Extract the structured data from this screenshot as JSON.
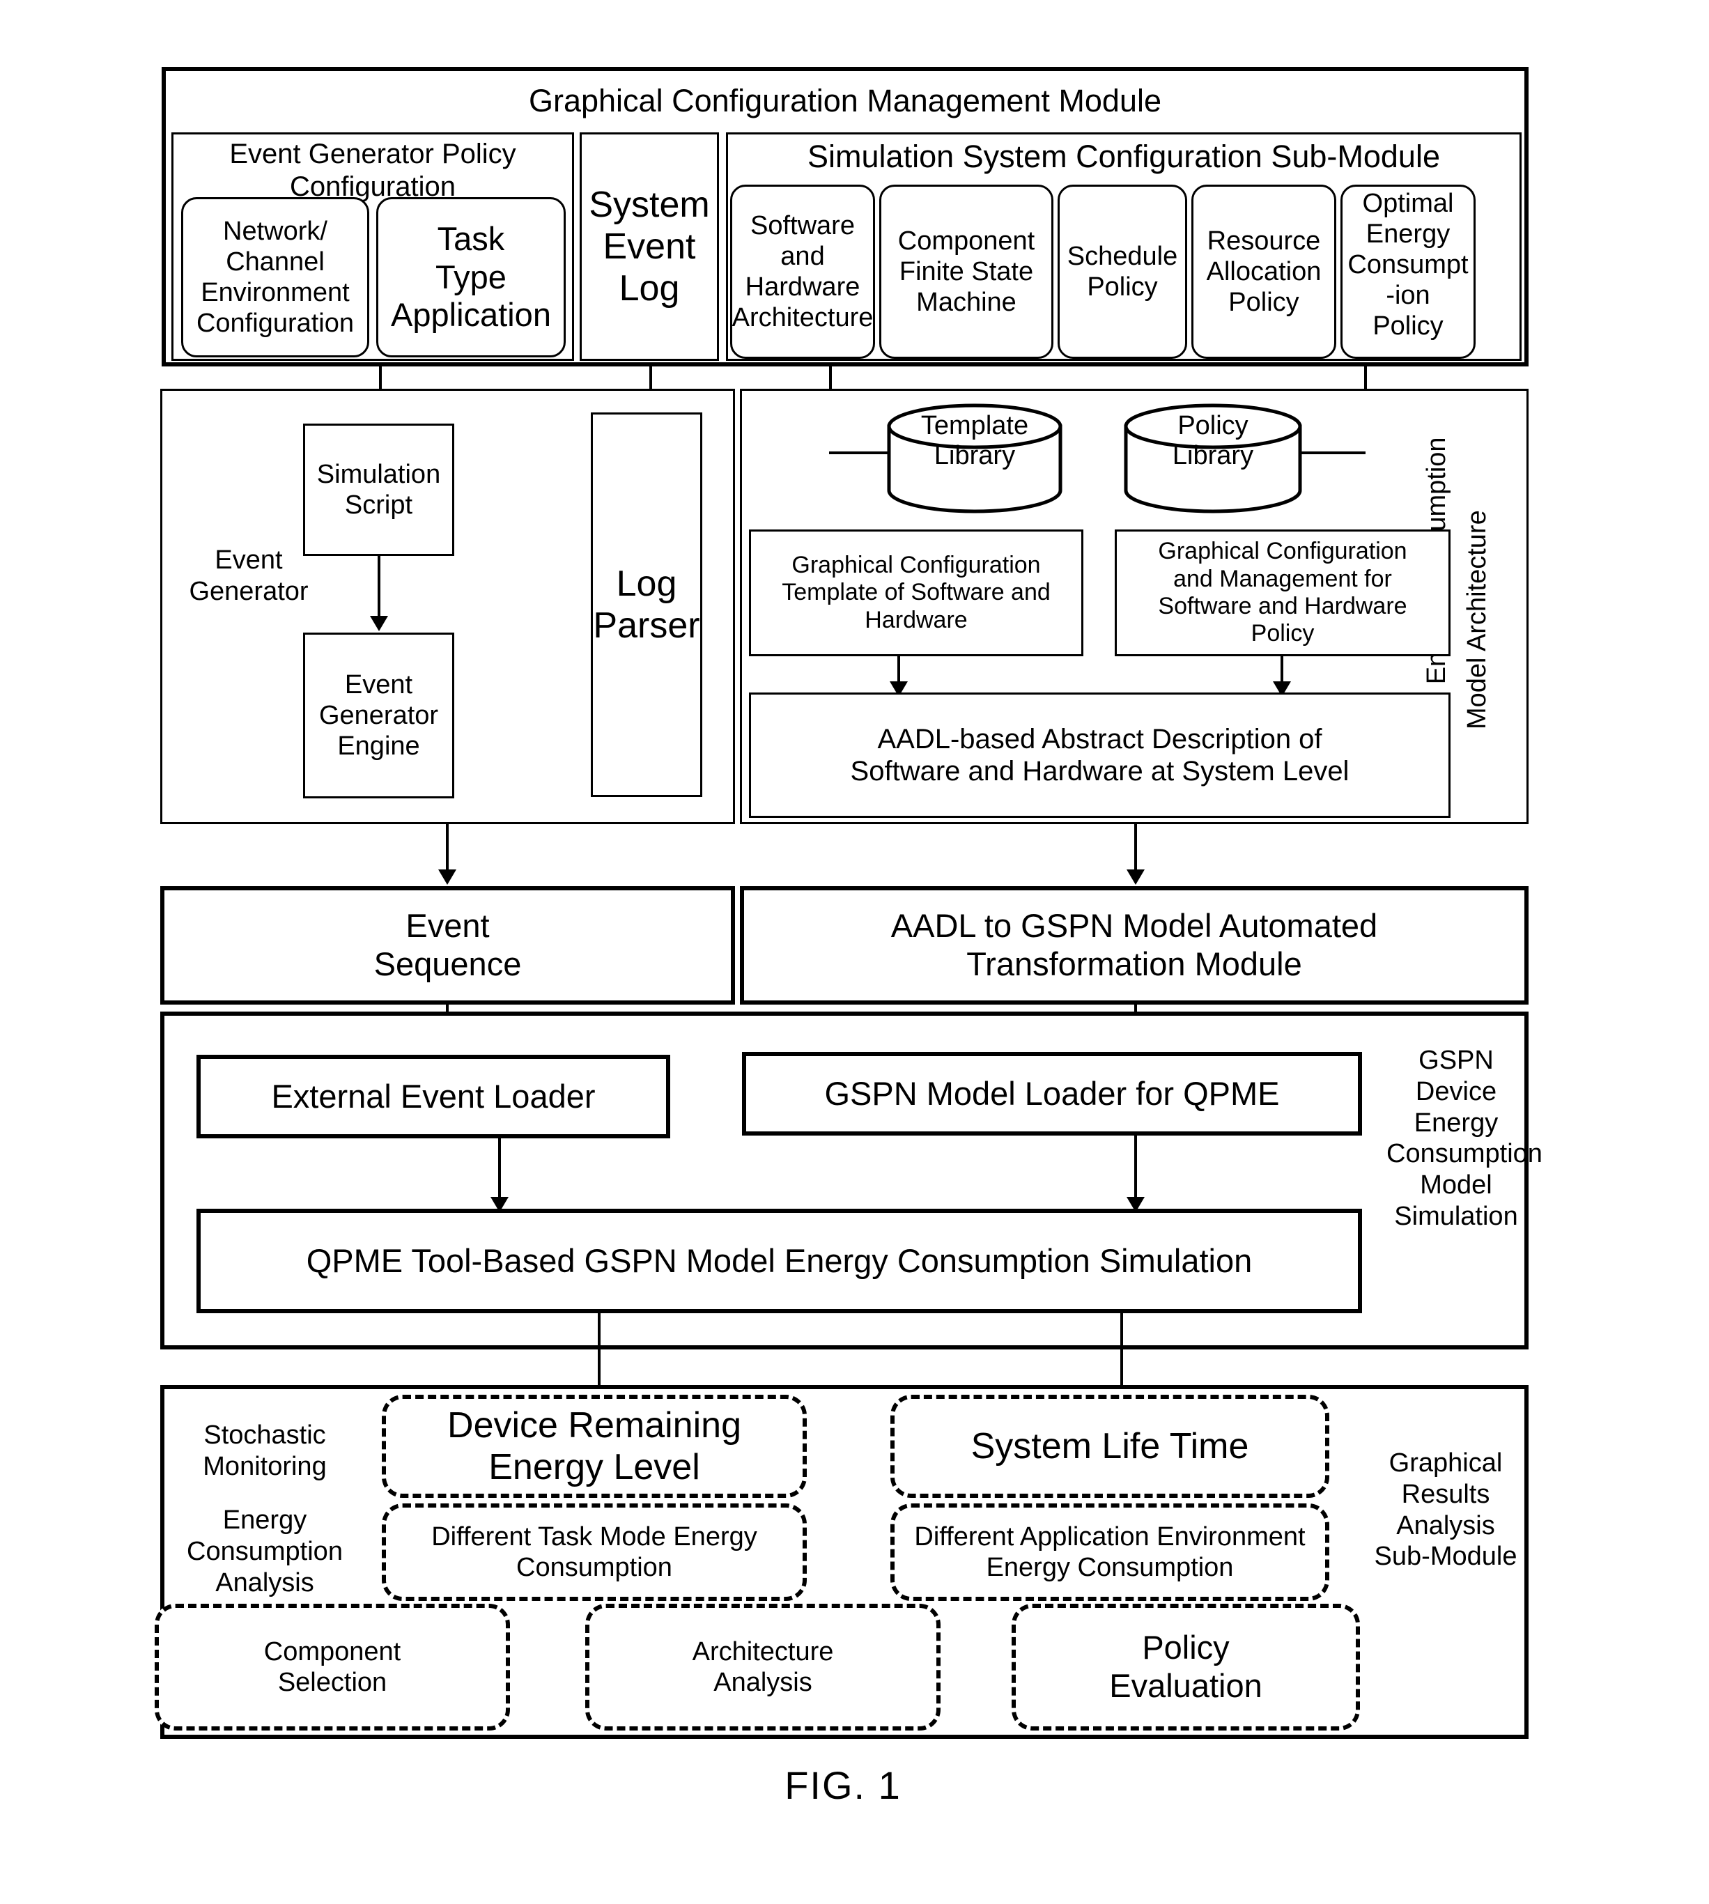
{
  "figure": {
    "caption": "FIG. 1"
  },
  "top_module": {
    "title": "Graphical Configuration Management Module",
    "event_generator_policy": {
      "title_line1": "Event Generator Policy",
      "title_line2": "Configuration",
      "items": [
        {
          "lines": [
            "Network/",
            "Channel",
            "Environment",
            "Configuration"
          ]
        },
        {
          "lines": [
            "Task",
            "Type",
            "Application"
          ]
        }
      ]
    },
    "system_event_log": {
      "lines": [
        "System",
        "Event",
        "Log"
      ]
    },
    "simulation_sub_module": {
      "title": "Simulation System Configuration Sub-Module",
      "items": [
        {
          "lines": [
            "Software",
            "and",
            "Hardware",
            "Architecture"
          ]
        },
        {
          "lines": [
            "Component",
            "Finite State",
            "Machine"
          ]
        },
        {
          "lines": [
            "Schedule",
            "Policy"
          ]
        },
        {
          "lines": [
            "Resource",
            "Allocation",
            "Policy"
          ]
        },
        {
          "lines": [
            "Optimal",
            "Energy",
            "Consumpt",
            "-ion",
            "Policy"
          ]
        }
      ]
    }
  },
  "tier2_left": {
    "side_label": {
      "lines": [
        "Event",
        "Generator"
      ]
    },
    "simulation_script": {
      "lines": [
        "Simulation",
        "Script"
      ]
    },
    "event_generator_engine": {
      "lines": [
        "Event",
        "Generator",
        "Engine"
      ]
    },
    "log_parser": {
      "lines": [
        "Log",
        "Parser"
      ]
    }
  },
  "tier2_right": {
    "side_label_line1": "Device Energy Consumption",
    "side_label_line2": "Model Architecture",
    "template_library": {
      "lines": [
        "Template",
        "Library"
      ]
    },
    "policy_library": {
      "lines": [
        "Policy",
        "Library"
      ]
    },
    "template_box": {
      "lines": [
        "Graphical Configuration",
        "Template of Software and",
        "Hardware"
      ]
    },
    "policy_box": {
      "lines": [
        "Graphical Configuration",
        "and Management for",
        "Software and Hardware",
        "Policy"
      ]
    },
    "aadl_box": {
      "lines": [
        "AADL-based Abstract Description of",
        "Software and Hardware at System Level"
      ]
    }
  },
  "tier3": {
    "event_sequence": {
      "lines": [
        "Event",
        "Sequence"
      ]
    },
    "transformation_module": {
      "lines": [
        "AADL to GSPN Model Automated",
        "Transformation Module"
      ]
    }
  },
  "tier4": {
    "side_label": {
      "lines": [
        "GSPN",
        "Device",
        "Energy",
        "Consumption",
        "Model",
        "Simulation"
      ]
    },
    "external_event_loader": "External Event Loader",
    "gspn_model_loader": "GSPN Model Loader for QPME",
    "qpme_simulation": "QPME Tool-Based GSPN Model Energy Consumption Simulation"
  },
  "tier5": {
    "left_label_a": {
      "lines": [
        "Stochastic",
        "Monitoring"
      ]
    },
    "left_label_b": {
      "lines": [
        "Energy",
        "Consumption",
        "Analysis"
      ]
    },
    "right_label": {
      "lines": [
        "Graphical",
        "Results",
        "Analysis",
        "Sub-Module"
      ]
    },
    "device_remaining": {
      "lines": [
        "Device Remaining",
        "Energy Level"
      ]
    },
    "system_life_time": {
      "lines": [
        "System Life Time"
      ]
    },
    "task_mode": {
      "lines": [
        "Different Task Mode Energy",
        "Consumption"
      ]
    },
    "app_env": {
      "lines": [
        "Different Application Environment",
        "Energy Consumption"
      ]
    },
    "component_selection": {
      "lines": [
        "Component",
        "Selection"
      ]
    },
    "architecture_analysis": {
      "lines": [
        "Architecture",
        "Analysis"
      ]
    },
    "policy_evaluation": {
      "lines": [
        "Policy",
        "Evaluation"
      ]
    }
  }
}
